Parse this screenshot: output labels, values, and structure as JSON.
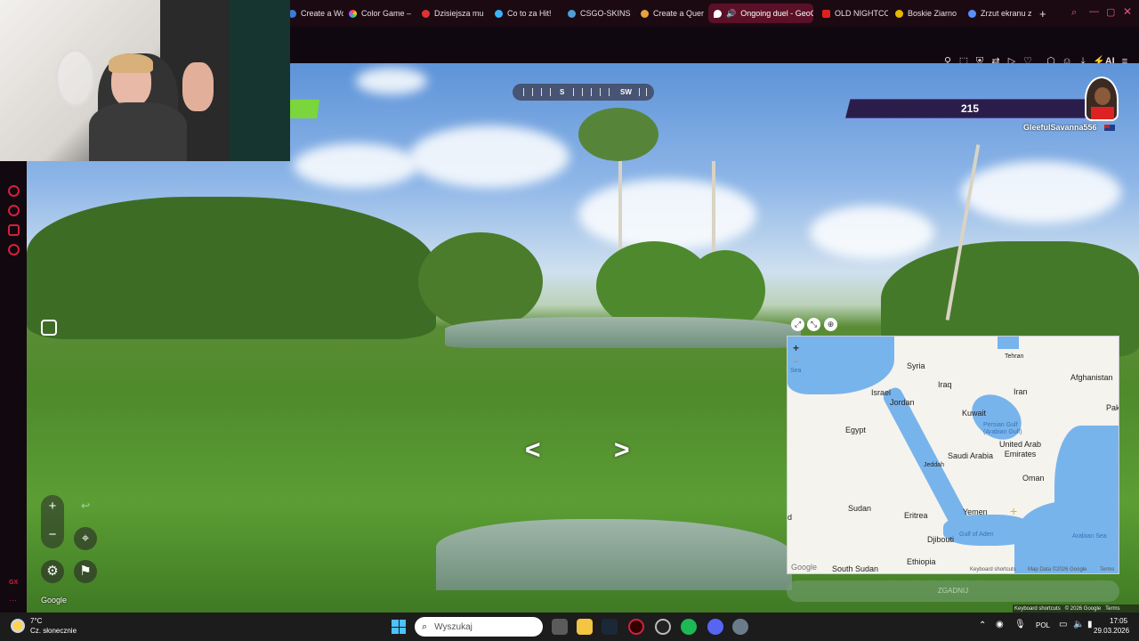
{
  "browser": {
    "tabs": [
      {
        "label": "Create a Worl",
        "color": "#3a7bd5"
      },
      {
        "label": "Color Game –",
        "color": "#d95fd0"
      },
      {
        "label": "Dzisiejsza mu",
        "color": "#d33"
      },
      {
        "label": "Co to za Hit!",
        "color": "#3bb3ff"
      },
      {
        "label": "CSGO-SKINS",
        "color": "#4e9fd8"
      },
      {
        "label": "Create a Quer",
        "color": "#e6a23c"
      },
      {
        "label": "Ongoing duel - GeoG",
        "color": "#fff",
        "active": true
      },
      {
        "label": "OLD NIGHTCO",
        "color": "#e02020"
      },
      {
        "label": "Boskie Ziarno",
        "color": "#e6b800"
      },
      {
        "label": "Zrzut ekranu z",
        "color": "#5a8fff"
      }
    ],
    "new_tab_label": "+",
    "toolbar_icons": [
      "pin-icon",
      "snapshot-icon",
      "shield-icon",
      "translate-icon",
      "play-icon",
      "heart-icon",
      "extensions-icon",
      "user-icon",
      "download-icon",
      "ai-icon",
      "menu-icon"
    ],
    "ai_label": "AI"
  },
  "hud": {
    "compass_s": "S",
    "compass_sw": "SW",
    "opponent_score": "215",
    "opponent_name": "GleefulSavanna556"
  },
  "map": {
    "labels": {
      "syria": "Syria",
      "iraq": "Iraq",
      "iran": "Iran",
      "afghanistan": "Afghanistan",
      "israel": "Israel",
      "jordan": "Jordan",
      "kuwait": "Kuwait",
      "pak": "Pak",
      "egypt": "Egypt",
      "saudi": "Saudi Arabia",
      "uae": "United Arab\nEmirates",
      "oman": "Oman",
      "jeddah": "Jeddah",
      "sudan": "Sudan",
      "eritrea": "Eritrea",
      "yemen": "Yemen",
      "djibouti": "Djibouti",
      "ethiopia": "Ethiopia",
      "south_sudan": "South Sudan",
      "tehran": "Tehran",
      "d": "d"
    },
    "sea_labels": {
      "persian_gulf": "Persian Gulf\n(Arabian Gulf)",
      "gulf_aden": "Gulf of Aden",
      "arabian_sea": "Arabian Sea",
      "sea": "Sea"
    },
    "zoom_in": "+",
    "zoom_out": "−",
    "google": "Google",
    "keyboard_shortcuts": "Keyboard shortcuts",
    "map_data": "Map Data ©2026 Google",
    "terms": "Terms",
    "guess_label": "ZGADNIJ"
  },
  "street": {
    "google": "Google",
    "bottom_keyboard": "Keyboard shortcuts",
    "bottom_copyright": "© 2026 Google",
    "bottom_terms": "Terms",
    "arrow_left": "<",
    "arrow_right": ">",
    "zoom_in": "+",
    "zoom_out": "−"
  },
  "taskbar": {
    "weather_temp": "7°C",
    "weather_desc": "Cz. słonecznie",
    "search_placeholder": "Wyszukaj",
    "lang": "POL",
    "time": "17:05",
    "date": "29.03.2026"
  }
}
